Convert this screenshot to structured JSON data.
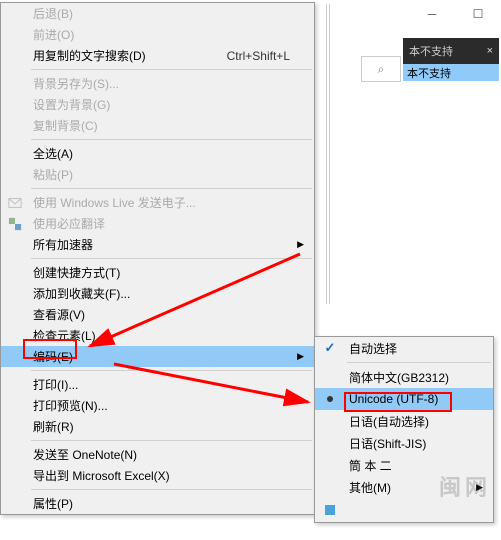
{
  "main_menu": {
    "back": "后退(B)",
    "forward": "前进(O)",
    "paste_search": "用复制的文字搜索(D)",
    "paste_search_shortcut": "Ctrl+Shift+L",
    "save_bg_as": "背景另存为(S)...",
    "set_as_bg": "设置为背景(G)",
    "copy_bg": "复制背景(C)",
    "select_all": "全选(A)",
    "paste": "粘贴(P)",
    "windows_live": "使用 Windows Live 发送电子...",
    "bing_translate": "使用必应翻译",
    "all_accelerators": "所有加速器",
    "create_shortcut": "创建快捷方式(T)",
    "add_favorites": "添加到收藏夹(F)...",
    "view_source": "查看源(V)",
    "inspect": "检查元素(L)",
    "encoding": "编码(E)",
    "print": "打印(I)...",
    "print_preview": "打印预览(N)...",
    "refresh": "刷新(R)",
    "send_onenote": "发送至 OneNote(N)",
    "export_excel": "导出到 Microsoft Excel(X)",
    "properties": "属性(P)"
  },
  "submenu": {
    "auto": "自动选择",
    "gb2312": "简体中文(GB2312)",
    "utf8": "Unicode (UTF-8)",
    "jp_auto": "日语(自动选择)",
    "shift_jis": "日语(Shift-JIS)",
    "jp_euc": "筒 本 ⼆",
    "other": "其他(M)"
  },
  "bg": {
    "tab_text": "本不支持",
    "banner_text": "本不支持"
  },
  "watermark": "闽网"
}
